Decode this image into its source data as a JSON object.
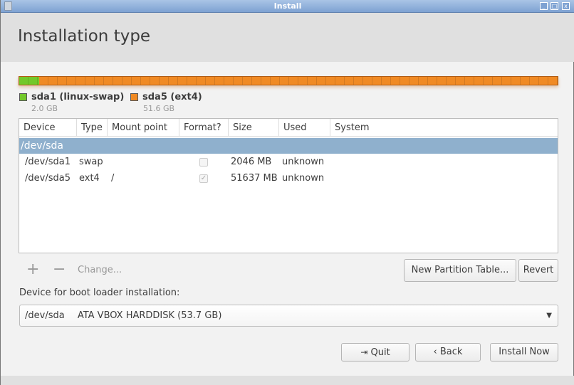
{
  "window": {
    "title": "Install"
  },
  "header": {
    "title": "Installation type"
  },
  "partition_bar": {
    "unit": "GB",
    "partitions": [
      {
        "name": "sda1 (linux-swap)",
        "size": "2.0 GB",
        "size_gb": 2.0,
        "color": "#73c82a"
      },
      {
        "name": "sda5 (ext4)",
        "size": "51.6 GB",
        "size_gb": 51.6,
        "color": "#f08a24"
      }
    ]
  },
  "table": {
    "columns": [
      "Device",
      "Type",
      "Mount point",
      "Format?",
      "Size",
      "Used",
      "System"
    ],
    "disk": "/dev/sda",
    "rows": [
      {
        "device": "/dev/sda1",
        "type": "swap",
        "mount": "",
        "format": false,
        "size": "2046 MB",
        "used": "unknown",
        "system": ""
      },
      {
        "device": "/dev/sda5",
        "type": "ext4",
        "mount": "/",
        "format": true,
        "size": "51637 MB",
        "used": "unknown",
        "system": ""
      }
    ]
  },
  "toolbar": {
    "add": "+",
    "remove": "−",
    "change": "Change...",
    "new_table": "New Partition Table...",
    "revert": "Revert"
  },
  "bootloader": {
    "label": "Device for boot loader installation:",
    "device": "/dev/sda",
    "description": "ATA VBOX HARDDISK (53.7 GB)"
  },
  "buttons": {
    "quit": "Quit",
    "back": "Back",
    "install": "Install Now"
  }
}
